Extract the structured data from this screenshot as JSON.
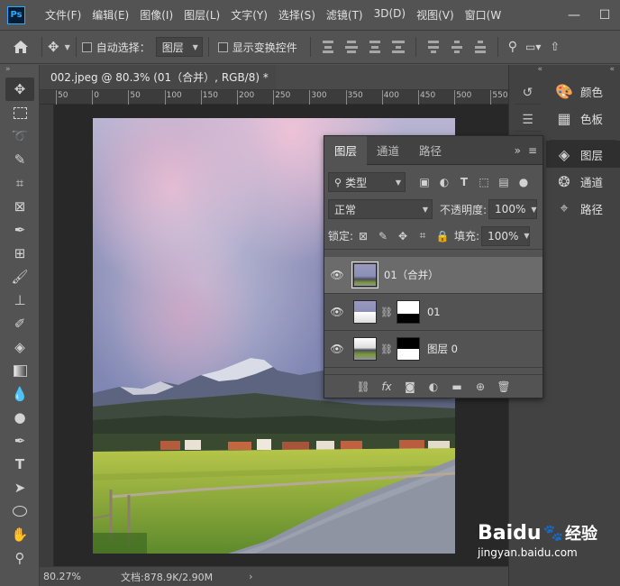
{
  "app": {
    "logo": "Ps"
  },
  "menu": {
    "items": [
      "文件(F)",
      "编辑(E)",
      "图像(I)",
      "图层(L)",
      "文字(Y)",
      "选择(S)",
      "滤镜(T)",
      "3D(D)",
      "视图(V)",
      "窗口(W"
    ]
  },
  "window_controls": {
    "minimize": "—",
    "maximize": "☐",
    "close": "✕"
  },
  "options": {
    "auto_select_label": "自动选择：",
    "auto_select_target": "图层",
    "show_transform_label": "显示变换控件"
  },
  "document": {
    "tab_title": "002.jpeg @ 80.3% (01（合并）, RGB/8) *",
    "ruler_labels": [
      "50",
      "0",
      "50",
      "100",
      "150",
      "200",
      "250",
      "300",
      "350",
      "400",
      "450",
      "500",
      "550"
    ]
  },
  "status": {
    "zoom": "80.27%",
    "doc_info": "文档:878.9K/2.90M"
  },
  "dock": {
    "items": [
      {
        "label": "颜色",
        "icon": "palette-icon"
      },
      {
        "label": "色板",
        "icon": "swatches-icon"
      },
      {
        "label": "图层",
        "icon": "layers-icon"
      },
      {
        "label": "通道",
        "icon": "channels-icon"
      },
      {
        "label": "路径",
        "icon": "paths-icon"
      }
    ]
  },
  "layers_panel": {
    "tabs": [
      "图层",
      "通道",
      "路径"
    ],
    "filter_kind": "类型",
    "blend_mode": "正常",
    "opacity_label": "不透明度:",
    "opacity_value": "100%",
    "lock_label": "锁定:",
    "fill_label": "填充:",
    "fill_value": "100%",
    "layers": [
      {
        "name": "01（合并）",
        "selected": true,
        "has_mask": false
      },
      {
        "name": "01",
        "selected": false,
        "has_mask": true
      },
      {
        "name": "图层 0",
        "selected": false,
        "has_mask": true
      }
    ]
  },
  "watermark": {
    "brand": "Baidu",
    "suffix": "经验",
    "url": "jingyan.baidu.com"
  }
}
